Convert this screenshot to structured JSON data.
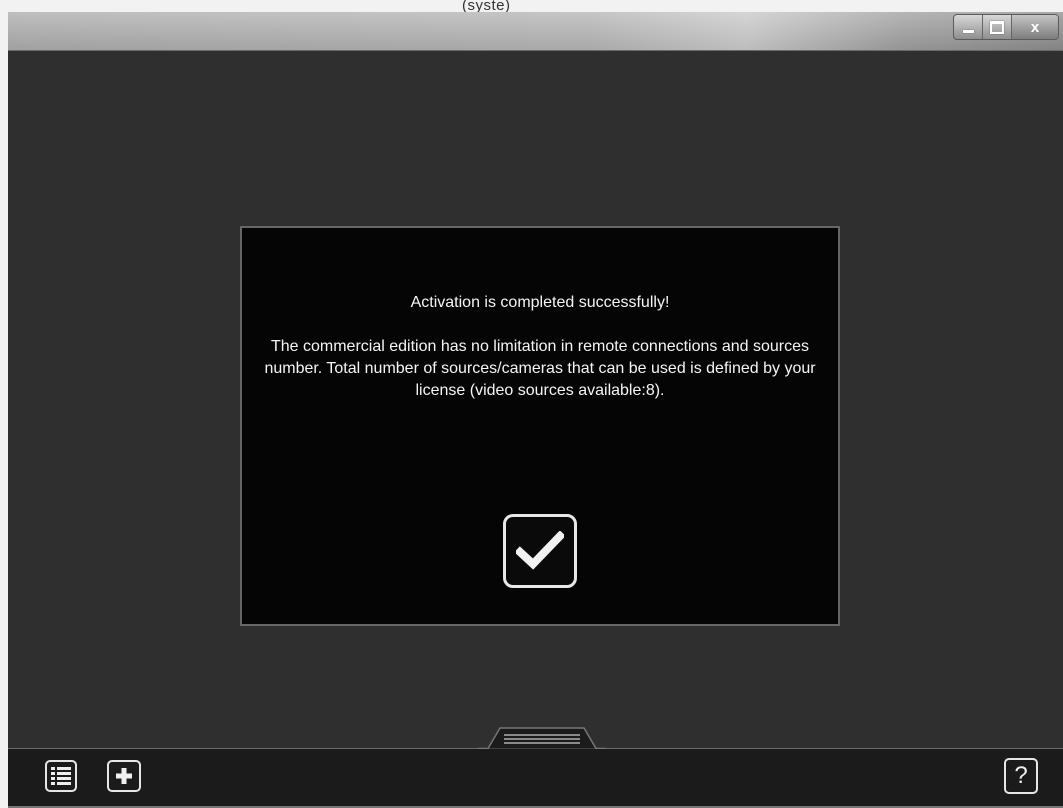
{
  "window": {
    "title_fragment": "(syste)",
    "controls": {
      "minimize": "minimize",
      "maximize": "maximize",
      "close": "x"
    }
  },
  "dialog": {
    "title": "Activation is completed successfully!",
    "message": "The commercial edition has no limitation in remote connections and sources number. Total number of sources/cameras that can be used is defined by your license (video sources available:8).",
    "confirm_icon": "checkmark-icon"
  },
  "bottombar": {
    "list_icon": "list-icon",
    "add_icon": "plus-icon",
    "help_label": "?"
  },
  "colors": {
    "background": "#2f2f2f",
    "dialog_background": "#050505",
    "text": "#f5f5f5",
    "bottombar": "#1b1b1b"
  }
}
